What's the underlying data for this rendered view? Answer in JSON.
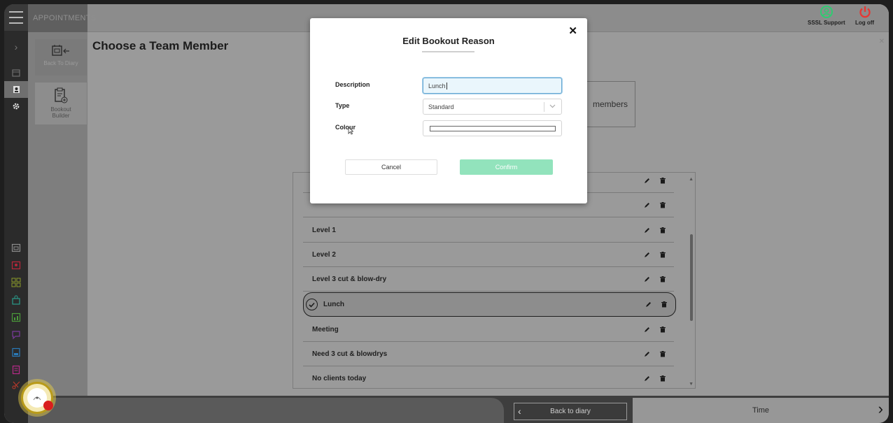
{
  "colors": {
    "rail_bg": "#2b2b2b",
    "confirm_bg": "#92e3bc",
    "focus_bg": "#eaf6fc",
    "logoff_red": "#e53935",
    "support_green": "#2ecc71"
  },
  "header": {
    "app_tab": "APPOINTMENTS",
    "support_label": "SSSL Support",
    "logoff_label": "Log off"
  },
  "side_panel": {
    "back_label": "Back To Diary",
    "bookout_label": "Bookout Builder"
  },
  "main": {
    "title": "Choose a Team Member",
    "members_text": "members"
  },
  "list": {
    "items": [
      {
        "label": "Level 1"
      },
      {
        "label": "Level 2"
      },
      {
        "label": "Level 3 cut & blow-dry"
      },
      {
        "label": "Lunch",
        "selected": true
      },
      {
        "label": "Meeting"
      },
      {
        "label": "Need 3 cut & blowdrys"
      },
      {
        "label": "No clients today"
      }
    ]
  },
  "modal": {
    "title": "Edit Bookout Reason",
    "description_label": "Description",
    "description_value": "Lunch",
    "type_label": "Type",
    "type_value": "Standard",
    "colour_label": "Colour",
    "cancel_label": "Cancel",
    "confirm_label": "Confirm"
  },
  "bottom": {
    "back_label": "Back to diary",
    "time_label": "Time"
  },
  "icons": {
    "menu": "hamburger-icon",
    "edit": "pencil-icon",
    "delete": "trash-icon",
    "check": "check-circle-icon"
  }
}
